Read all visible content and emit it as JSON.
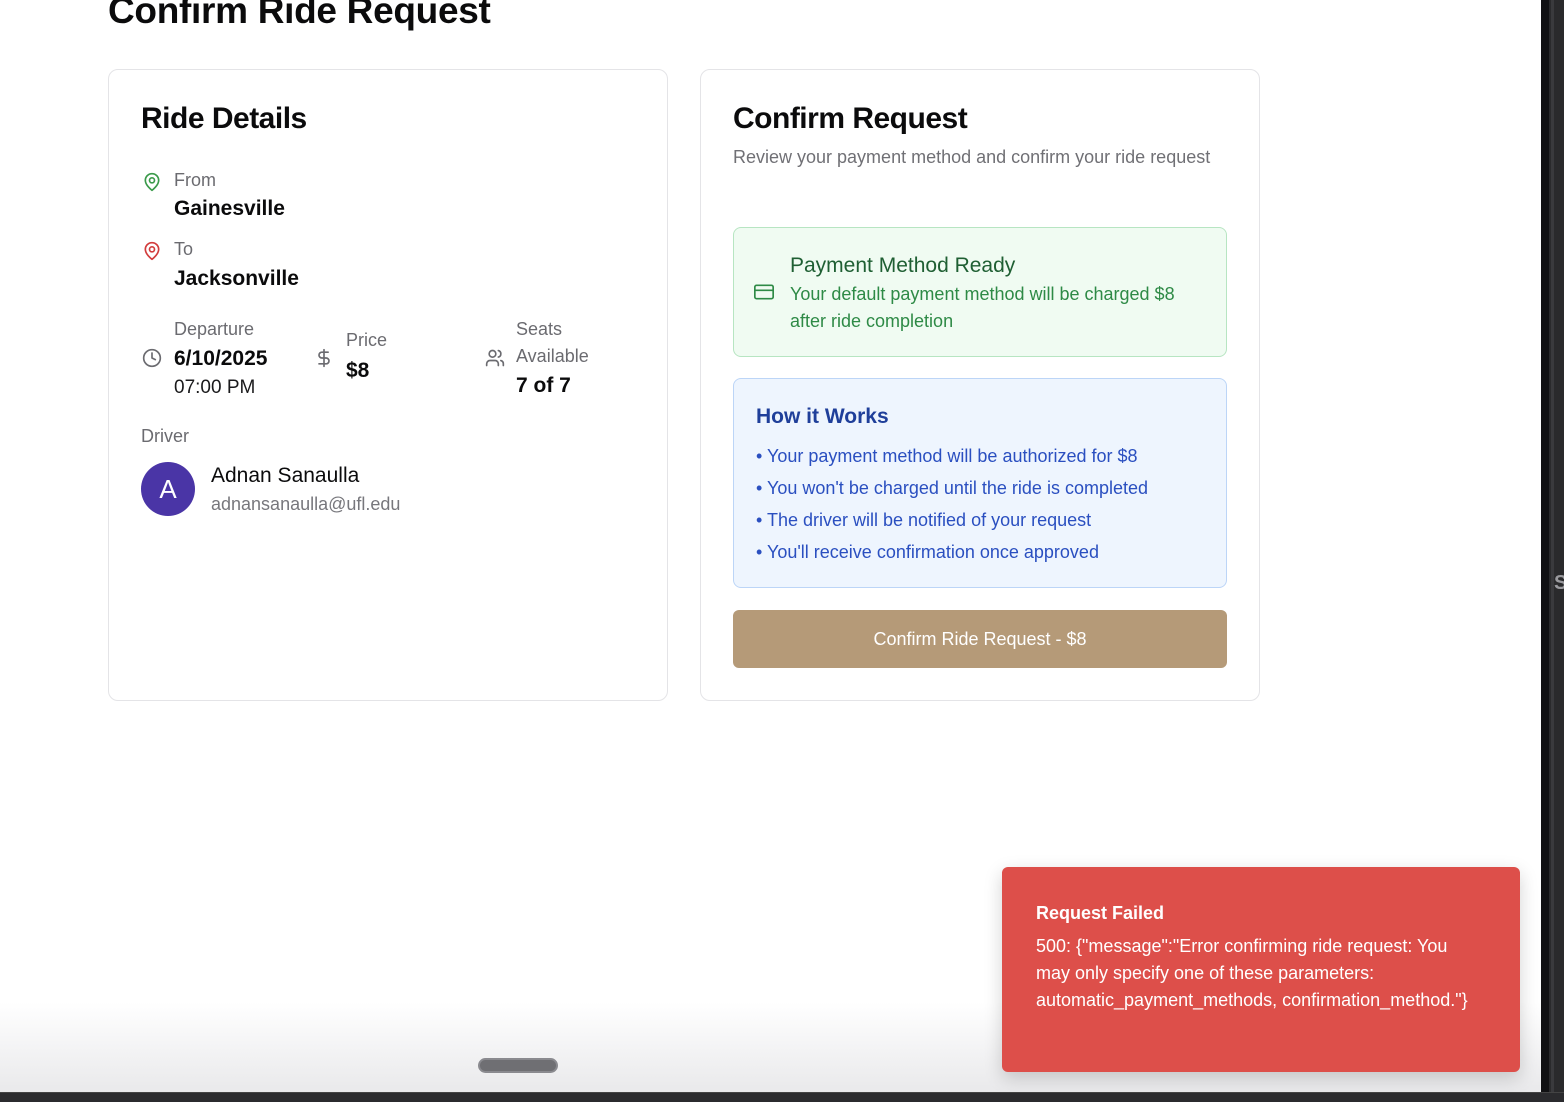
{
  "page": {
    "title": "Confirm Ride Request"
  },
  "ride_details": {
    "title": "Ride Details",
    "from": {
      "label": "From",
      "value": "Gainesville"
    },
    "to": {
      "label": "To",
      "value": "Jacksonville"
    },
    "departure": {
      "label": "Departure",
      "date": "6/10/2025",
      "time": "07:00 PM"
    },
    "price": {
      "label": "Price",
      "value": "$8"
    },
    "seats": {
      "label_line1": "Seats",
      "label_line2": "Available",
      "value": "7 of 7"
    },
    "driver": {
      "label": "Driver",
      "initial": "A",
      "name": "Adnan Sanaulla",
      "email": "adnansanaulla@ufl.edu"
    }
  },
  "confirm_request": {
    "title": "Confirm Request",
    "subtitle": "Review your payment method and confirm your ride request",
    "payment": {
      "title": "Payment Method Ready",
      "description": "Your default payment method will be charged $8 after ride completion"
    },
    "how_it_works": {
      "title": "How it Works",
      "items": [
        "• Your payment method will be authorized for $8",
        "• You won't be charged until the ride is completed",
        "• The driver will be notified of your request",
        "• You'll receive confirmation once approved"
      ]
    },
    "button_label": "Confirm Ride Request - $8"
  },
  "toast": {
    "title": "Request Failed",
    "message": "500: {\"message\":\"Error confirming ride request: You may only specify one of these parameters: automatic_payment_methods, confirmation_method.\"}"
  },
  "side_strip": {
    "letter": "S"
  },
  "colors": {
    "from_pin": "#3a9a4a",
    "to_pin": "#d23c3c",
    "avatar": "#4a35a6",
    "button": "#b59a78",
    "toast": "#dd4f4a",
    "payment_bg": "#f0fbf2",
    "how_bg": "#eef5fe"
  },
  "icons": {
    "from": "map-pin-icon",
    "to": "map-pin-icon",
    "departure": "clock-icon",
    "price": "dollar-icon",
    "seats": "users-icon",
    "payment": "credit-card-icon"
  }
}
